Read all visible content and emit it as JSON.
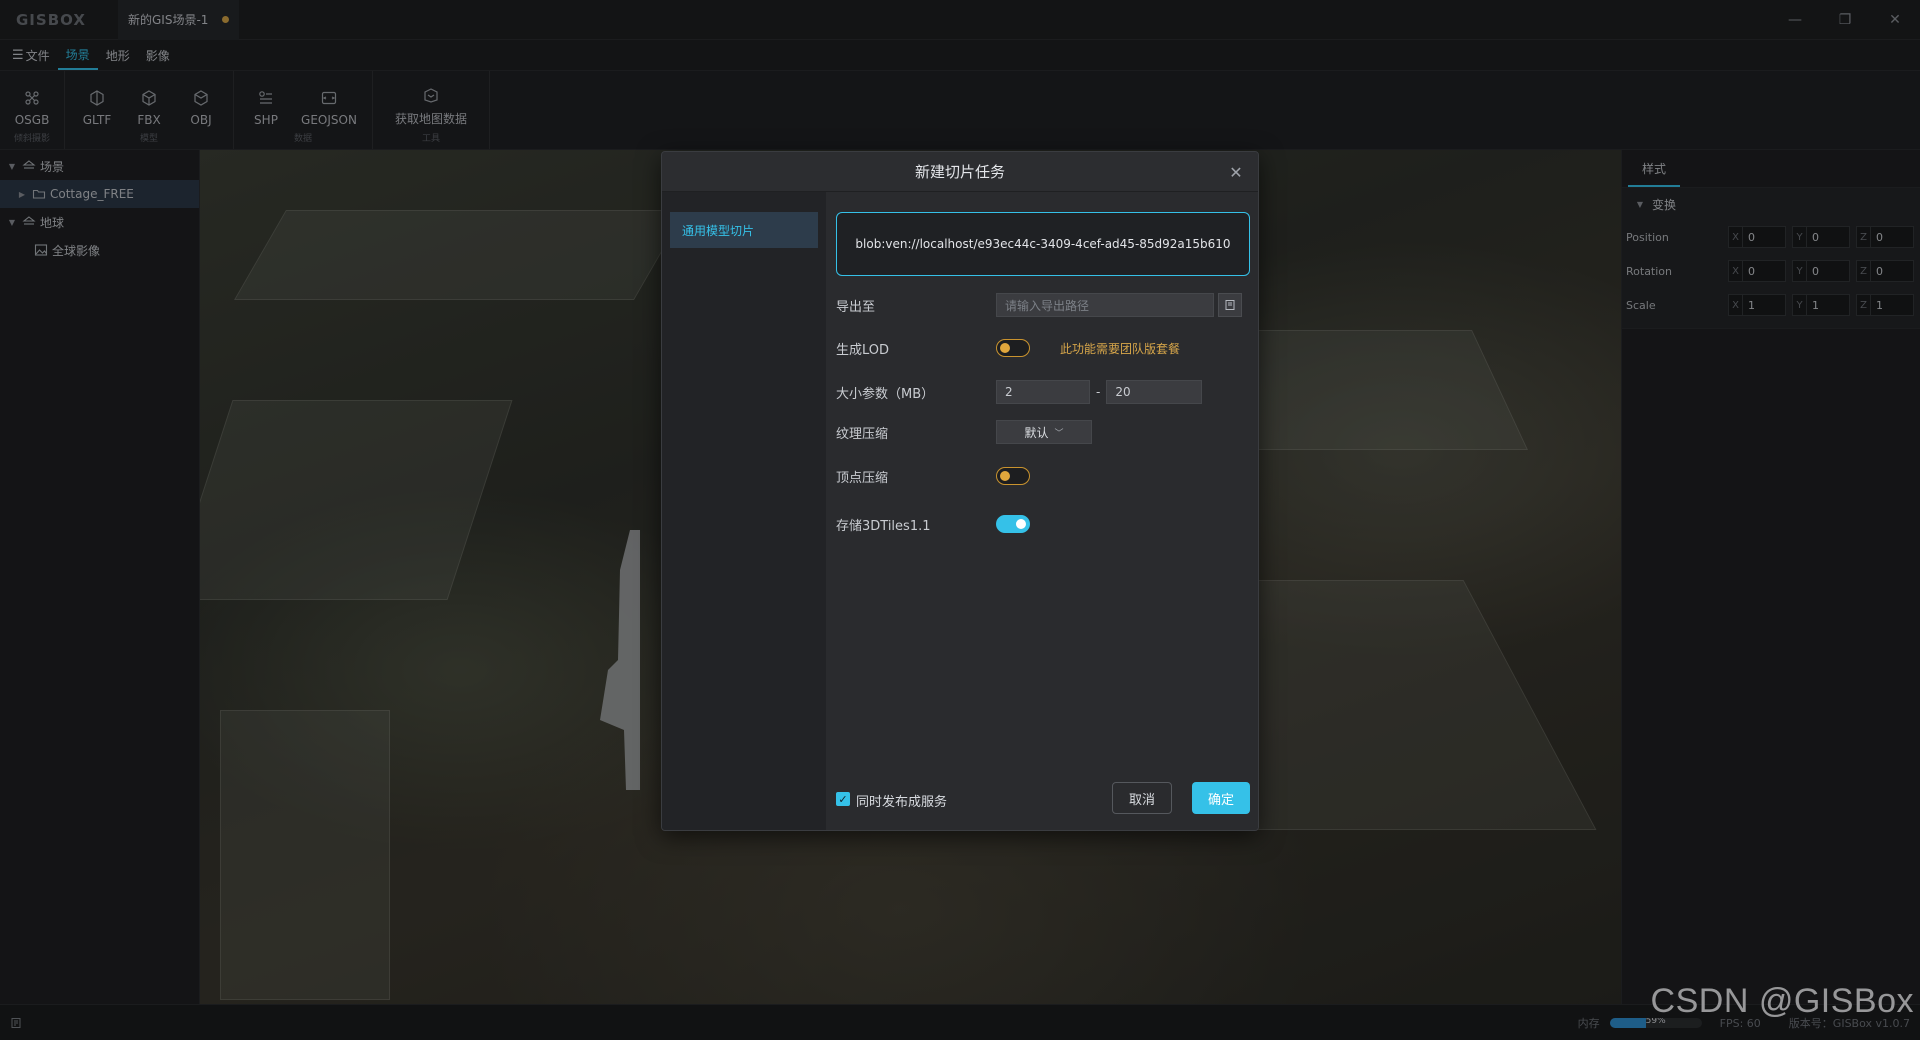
{
  "app": {
    "logo": "GISBOX",
    "doc_tab": "新的GIS场景-1"
  },
  "window": {
    "minimize": "—",
    "restore": "❐",
    "close": "✕"
  },
  "menu": {
    "hamburger": "☰",
    "items": [
      "文件",
      "场景",
      "地形",
      "影像"
    ],
    "active": "场景"
  },
  "ribbon": {
    "groups": [
      {
        "label": "倾斜摄影",
        "buttons": [
          {
            "label": "OSGB",
            "icon": "osgb-icon"
          }
        ]
      },
      {
        "label": "模型",
        "buttons": [
          {
            "label": "GLTF",
            "icon": "gltf-icon"
          },
          {
            "label": "FBX",
            "icon": "fbx-icon"
          },
          {
            "label": "OBJ",
            "icon": "obj-icon"
          }
        ]
      },
      {
        "label": "数据",
        "buttons": [
          {
            "label": "SHP",
            "icon": "shp-icon"
          },
          {
            "label": "GEOJSON",
            "icon": "geojson-icon"
          }
        ]
      },
      {
        "label": "工具",
        "buttons": [
          {
            "label": "获取地图数据",
            "icon": "map-data-icon"
          }
        ]
      }
    ]
  },
  "tree": {
    "scene": "场景",
    "scene_child": "Cottage_FREE",
    "earth": "地球",
    "earth_child": "全球影像"
  },
  "right_panel": {
    "tab": "样式",
    "section": "变换",
    "rows": [
      {
        "label": "Position",
        "x": "0",
        "y": "0",
        "z": "0"
      },
      {
        "label": "Rotation",
        "x": "0",
        "y": "0",
        "z": "0"
      },
      {
        "label": "Scale",
        "x": "1",
        "y": "1",
        "z": "1"
      }
    ],
    "axis": {
      "x": "X",
      "y": "Y",
      "z": "Z"
    }
  },
  "status": {
    "memory_label": "内存",
    "memory_value": "59%",
    "memory_fraction": 0.4,
    "fps": "FPS: 60",
    "version": "版本号：GISBox v1.0.7",
    "watermark": "CSDN @GISBox"
  },
  "modal": {
    "title": "新建切片任务",
    "close": "✕",
    "side_item": "通用模型切片",
    "source_url": "blob:ven://localhost/e93ec44c-3409-4cef-ad45-85d92a15b610",
    "export_label": "导出至",
    "export_placeholder": "请输入导出路径",
    "lod_label": "生成LOD",
    "lod_warning": "此功能需要团队版套餐",
    "size_label": "大小参数（MB）",
    "size_min": "2",
    "size_max": "20",
    "size_sep": "-",
    "texture_label": "纹理压缩",
    "texture_value": "默认",
    "vertex_label": "顶点压缩",
    "store_label": "存储3DTiles1.1",
    "publish_label": "同时发布成服务",
    "cancel": "取消",
    "ok": "确定"
  },
  "colors": {
    "accent": "#35c1e8",
    "warning": "#d7a64a",
    "toggle_off": "#e0a63c"
  }
}
